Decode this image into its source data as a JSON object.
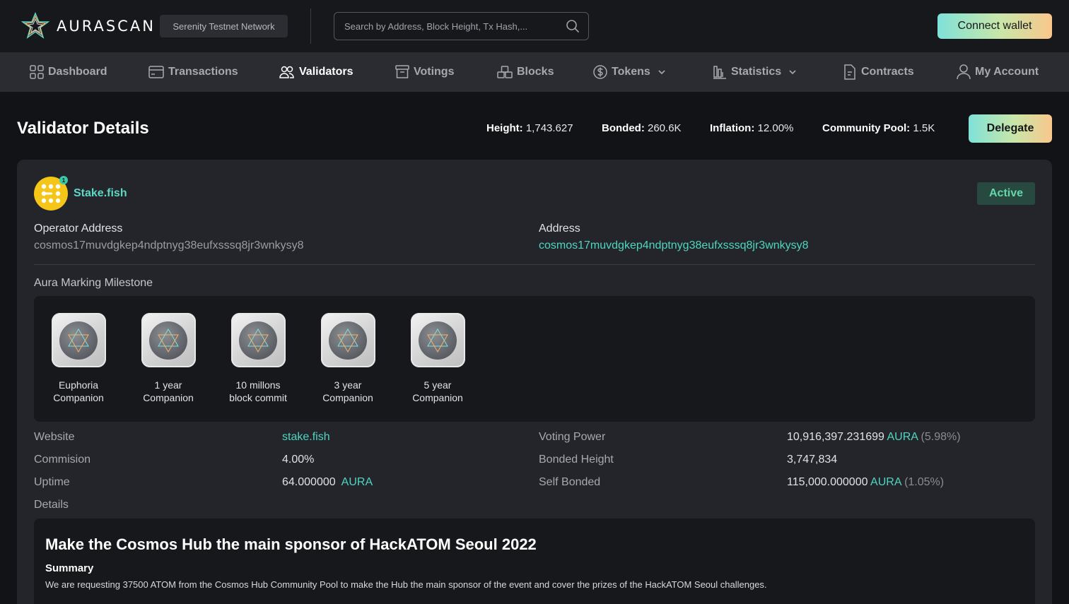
{
  "header": {
    "brand": "AURASCAN",
    "network": "Serenity Testnet Network",
    "search_placeholder": "Search by Address, Block Height, Tx Hash,...",
    "connect_label": "Connect wallet"
  },
  "nav": {
    "items": [
      {
        "label": "Dashboard",
        "icon": "grid-icon"
      },
      {
        "label": "Transactions",
        "icon": "card-icon"
      },
      {
        "label": "Validators",
        "icon": "users-icon",
        "active": true
      },
      {
        "label": "Votings",
        "icon": "archive-icon"
      },
      {
        "label": "Blocks",
        "icon": "blocks-icon"
      },
      {
        "label": "Tokens",
        "icon": "coin-icon"
      },
      {
        "label": "Statistics",
        "icon": "bar-chart-icon"
      },
      {
        "label": "Contracts",
        "icon": "document-icon"
      },
      {
        "label": "My Account",
        "icon": "user-icon"
      }
    ]
  },
  "page": {
    "title": "Validator Details",
    "stats": {
      "height_label": "Height:",
      "height_value": "1,743.627",
      "bonded_label": "Bonded:",
      "bonded_value": "260.6K",
      "inflation_label": "Inflation:",
      "inflation_value": "12.00%",
      "pool_label": "Community Pool:",
      "pool_value": "1.5K"
    },
    "delegate_label": "Delegate"
  },
  "validator": {
    "rank": "1",
    "name": "Stake.fish",
    "status": "Active",
    "operator_label": "Operator Address",
    "operator_address": "cosmos17muvdgkep4ndptnyg38eufxsssq8jr3wnkysy8",
    "address_label": "Address",
    "address": "cosmos17muvdgkep4ndptnyg38eufxsssq8jr3wnkysy8",
    "milestone_label": "Aura Marking Milestone",
    "milestones": [
      {
        "line1": "Euphoria",
        "line2": "Companion"
      },
      {
        "line1": "1 year",
        "line2": "Companion"
      },
      {
        "line1": "10 millons",
        "line2": "block commit"
      },
      {
        "line1": "3 year",
        "line2": "Companion"
      },
      {
        "line1": "5 year",
        "line2": "Companion"
      }
    ],
    "website_label": "Website",
    "website": "stake.fish",
    "commission_label": "Commision",
    "commission": "4.00%",
    "uptime_label": "Uptime",
    "uptime": "64.000000",
    "uptime_unit": "AURA",
    "voting_power_label": "Voting Power",
    "voting_power": "10,916,397.231699",
    "voting_power_unit": "AURA",
    "voting_power_pct": "(5.98%)",
    "bonded_height_label": "Bonded Height",
    "bonded_height": "3,747,834",
    "self_bonded_label": "Self Bonded",
    "self_bonded": "115,000.000000",
    "self_bonded_unit": "AURA",
    "self_bonded_pct": "(1.05%)",
    "details_label": "Details",
    "details_title": "Make the Cosmos Hub the main sponsor of HackATOM Seoul 2022",
    "summary_heading": "Summary",
    "summary_text": "We are requesting 37500 ATOM from the Cosmos Hub Community Pool to make the Hub the main sponsor of the event and cover the prizes of the HackATOM Seoul challenges."
  },
  "colors": {
    "accent": "#4fd6c0",
    "active_badge_bg": "#27493f",
    "active_badge_text": "#63d7a9",
    "avatar": "#f5c518"
  }
}
